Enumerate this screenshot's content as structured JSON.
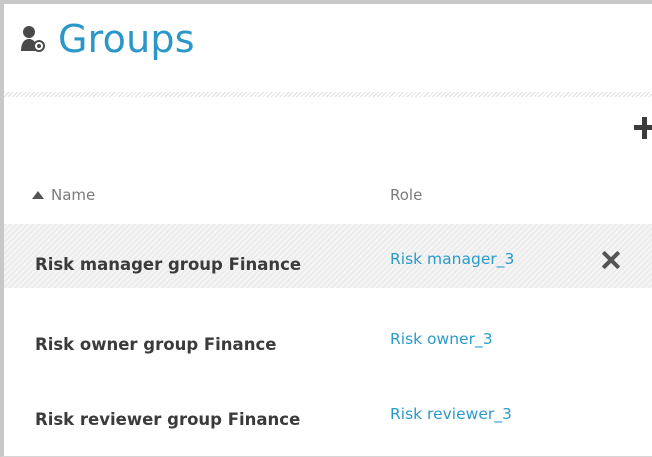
{
  "header": {
    "title": "Groups",
    "icon": "user-group-icon"
  },
  "toolbar": {
    "add_icon": "plus-icon"
  },
  "table": {
    "columns": [
      {
        "label": "Name",
        "sort": "ascending"
      },
      {
        "label": "Role"
      }
    ],
    "rows": [
      {
        "name": "Risk manager group Finance",
        "role": "Risk manager_3",
        "highlighted": true
      },
      {
        "name": "Risk owner group Finance",
        "role": "Risk owner_3",
        "highlighted": false
      },
      {
        "name": "Risk reviewer group Finance",
        "role": "Risk reviewer_3",
        "highlighted": false
      }
    ],
    "delete_icon": "close-x-icon"
  },
  "colors": {
    "accent": "#2a97c8",
    "text": "#3b3b3b",
    "muted": "#7b7b7b"
  }
}
